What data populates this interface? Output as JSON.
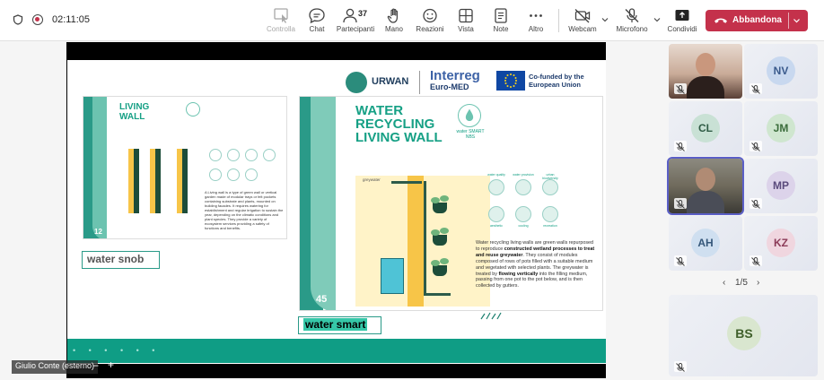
{
  "topbar": {
    "timer": "02:11:05",
    "buttons": [
      {
        "label": "Controlla",
        "icon": "pointer-icon",
        "disabled": true
      },
      {
        "label": "Chat",
        "icon": "chat-icon"
      },
      {
        "label": "Partecipanti",
        "icon": "people-icon",
        "count": "37"
      },
      {
        "label": "Mano",
        "icon": "hand-icon"
      },
      {
        "label": "Reazioni",
        "icon": "smiley-icon"
      },
      {
        "label": "Vista",
        "icon": "grid-icon"
      },
      {
        "label": "Note",
        "icon": "notes-icon"
      },
      {
        "label": "Altro",
        "icon": "more-icon"
      },
      {
        "label": "Webcam",
        "icon": "camera-off-icon"
      },
      {
        "label": "Microfono",
        "icon": "mic-off-icon"
      },
      {
        "label": "Condividi",
        "icon": "share-icon"
      }
    ],
    "leave_label": "Abbandona"
  },
  "slide": {
    "header": {
      "urwan": "URWAN",
      "interreg": "Interreg",
      "interreg_sub": "Euro-MED",
      "cofunded": "Co-funded by the European Union"
    },
    "left_card": {
      "title": "LIVING WALL",
      "number": "12",
      "text": "A Living wall is a type of green wall or vertical garden made of modular trays or felt pockets containing substrate and plants, mounted on building facades. It requires watering for establishment and regular irrigation to sustain the year, depending on the climatic conditions and plant species. They provide a variety of ecosystem services providing a safety of functions and benefits."
    },
    "big_card": {
      "title": "WATER RECYCLING LIVING WALL",
      "subtitle": "water SMART NBS",
      "number": "45",
      "greywater_label": "greywater",
      "text_parts": [
        "Water recycling living walls are green walls repurposed to reproduce ",
        "constructed wetland processes to treat and reuse greywater",
        ". They consist of modules composed of rows of pots filled with a suitable medium and vegetated with selected plants. The greywater is treated by ",
        "flowing vertically",
        " into the filling medium, passing from one pot to the pot below, and is then collected by gutters."
      ],
      "icon_labels": [
        "water quality",
        "water provision",
        "urban biodiversity",
        "aesthetic",
        "cooling",
        "recreation"
      ]
    },
    "labels": {
      "box1": "water snob",
      "box2": "water smart"
    }
  },
  "presenter_tag": "Giulio Conte (esterno)",
  "participants": [
    {
      "initials": "",
      "has_video": true,
      "bg": "#d9c4b8"
    },
    {
      "initials": "NV",
      "bg": "#c8d8ef",
      "fg": "#3a5a8c"
    },
    {
      "initials": "CL",
      "bg": "#c9e1d5",
      "fg": "#2f5b45"
    },
    {
      "initials": "JM",
      "bg": "#cfe6cf",
      "fg": "#3b6d3b"
    },
    {
      "initials": "",
      "has_video": true,
      "bg": "#a89f8c"
    },
    {
      "initials": "MP",
      "bg": "#dcd3ea",
      "fg": "#5a4a7c"
    },
    {
      "initials": "AH",
      "bg": "#cfdff0",
      "fg": "#35577a"
    },
    {
      "initials": "KZ",
      "bg": "#f0d6df",
      "fg": "#8c3b58"
    },
    {
      "initials": "BS",
      "bg": "#d9e6cf",
      "fg": "#3f5f2a"
    }
  ],
  "pager": "1/5",
  "colors": {
    "accent": "#5b5fc7",
    "leave": "#c4314b",
    "slide_teal": "#16a085"
  }
}
